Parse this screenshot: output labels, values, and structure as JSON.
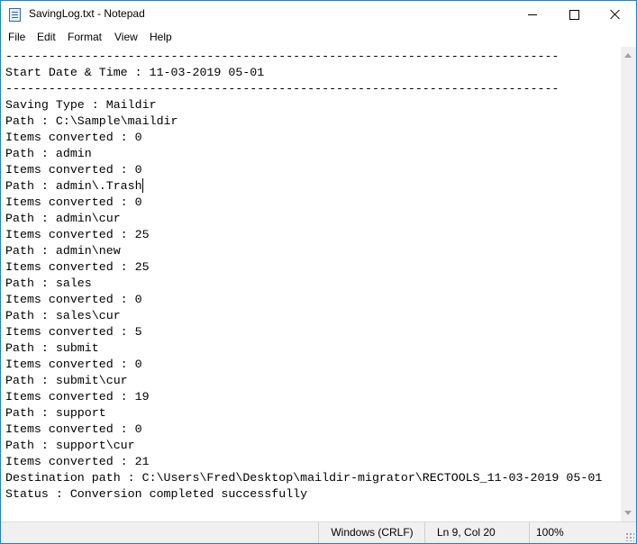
{
  "window": {
    "title": "SavingLog.txt - Notepad",
    "controls": {
      "minimize": "minimize",
      "maximize": "maximize",
      "close": "close"
    }
  },
  "menu": {
    "file": "File",
    "edit": "Edit",
    "format": "Format",
    "view": "View",
    "help": "Help"
  },
  "editor": {
    "content": "-----------------------------------------------------------------------------\nStart Date & Time : 11-03-2019 05-01\n-----------------------------------------------------------------------------\nSaving Type : Maildir\nPath : C:\\Sample\\maildir\nItems converted : 0\nPath : admin\nItems converted : 0\nPath : admin\\.Trash\nItems converted : 0\nPath : admin\\cur\nItems converted : 25\nPath : admin\\new\nItems converted : 25\nPath : sales\nItems converted : 0\nPath : sales\\cur\nItems converted : 5\nPath : submit\nItems converted : 0\nPath : submit\\cur\nItems converted : 19\nPath : support\nItems converted : 0\nPath : support\\cur\nItems converted : 21\nDestination path : C:\\Users\\Fred\\Desktop\\maildir-migrator\\RECTOOLS_11-03-2019 05-01\nStatus : Conversion completed successfully"
  },
  "statusbar": {
    "encoding": "Windows (CRLF)",
    "position": "Ln 9, Col 20",
    "zoom": "100%"
  },
  "colors": {
    "window_border": "#1883d7",
    "statusbar_bg": "#f0f0f0"
  }
}
